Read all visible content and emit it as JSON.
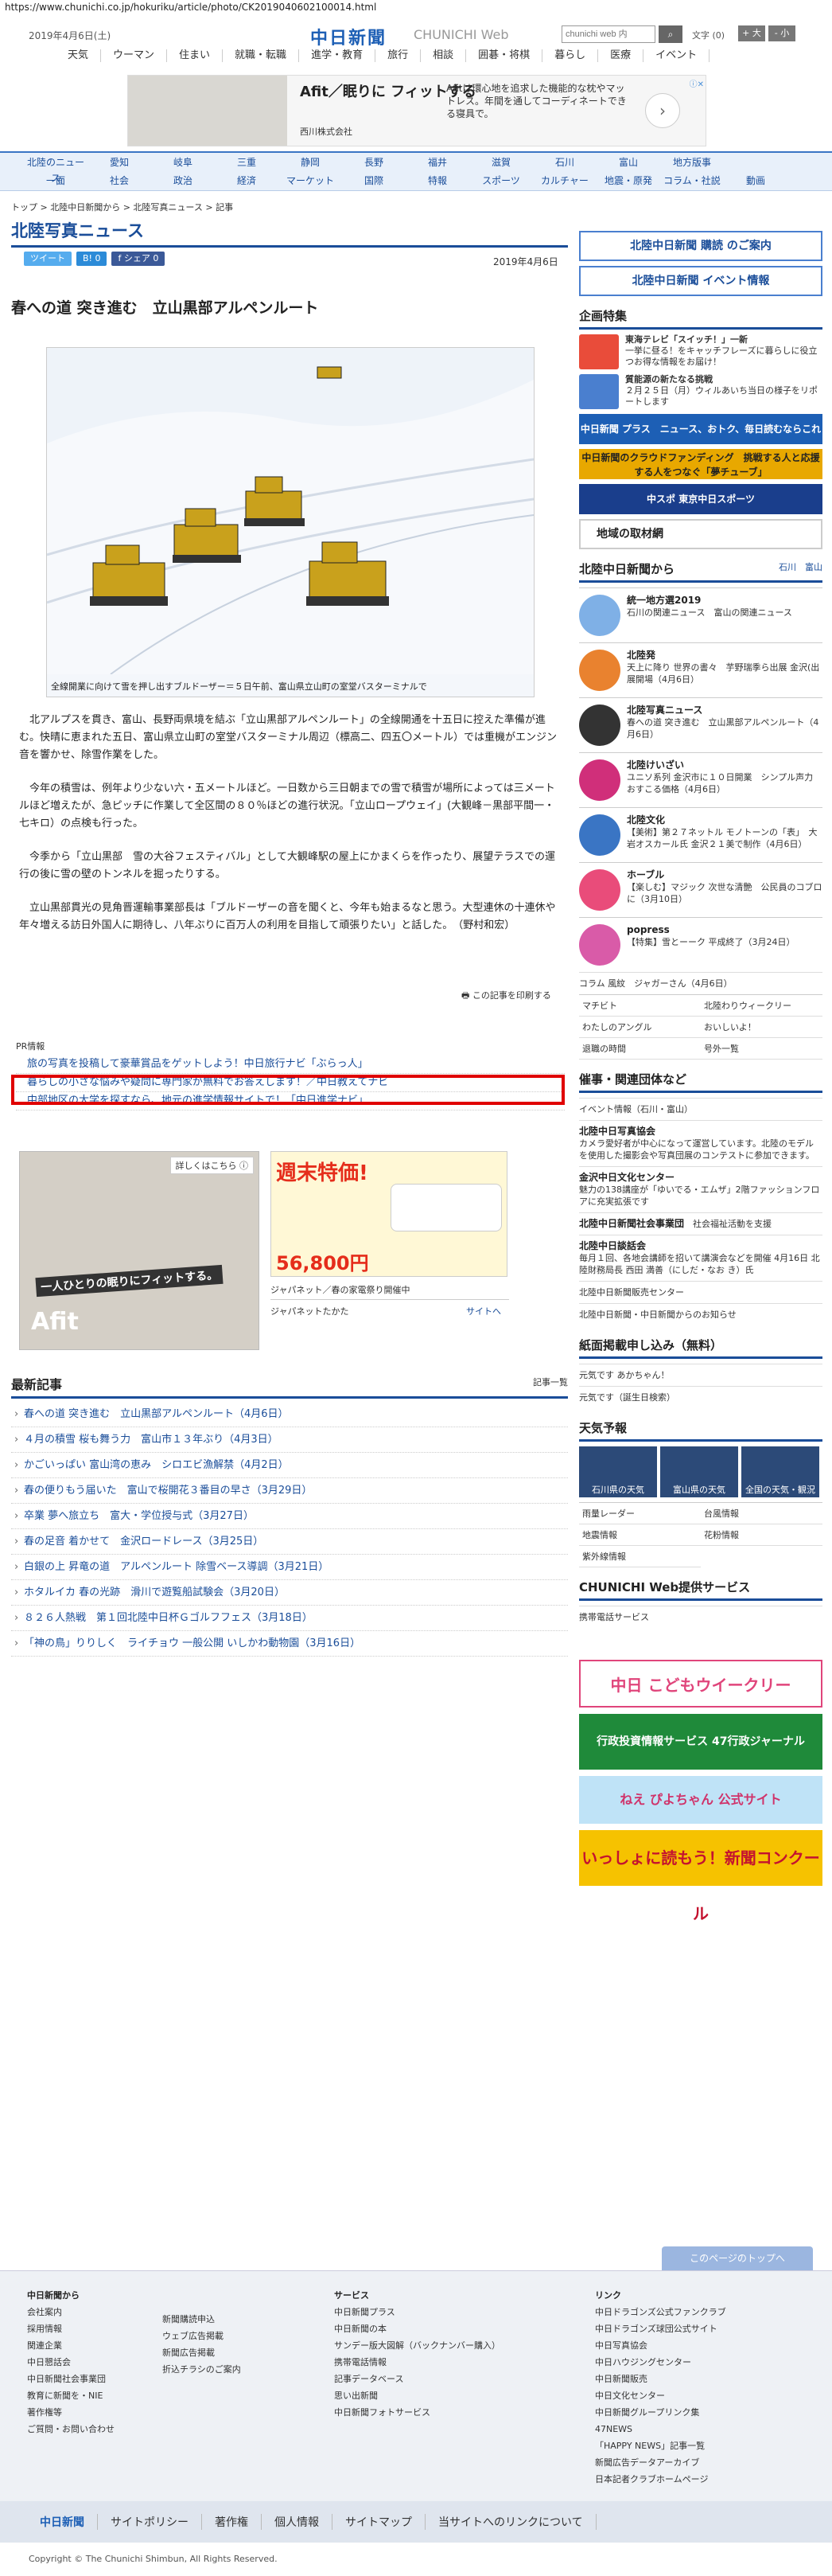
{
  "url": "https://www.chunichi.co.jp/hokuriku/article/photo/CK2019040602100014.html",
  "header": {
    "date": "2019年4月6日(土)",
    "logo": "中日新聞",
    "logo_sub": "CHUNICHI Web",
    "search_placeholder": "chunichi web 内",
    "fontsize_label": "文字 (0)",
    "font_large": "+ 大",
    "font_small": "- 小",
    "nav": [
      "天気",
      "ウーマン",
      "住まい",
      "就職・転職",
      "進学・教育",
      "旅行",
      "相談",
      "囲碁・将棋",
      "暮らし",
      "医療",
      "イベント"
    ]
  },
  "ad_top": {
    "title": "Afit／眠りに フィットする",
    "desc": "Afitは環心地を追求した機能的な枕やマットレス。年間を通してコーディネートできる寝具で。",
    "brand": "西川株式会社",
    "next": "›",
    "close": "ⓘ✕"
  },
  "bluenav": {
    "row1": [
      "北陸のニュース",
      "愛知",
      "岐阜",
      "三重",
      "静岡",
      "長野",
      "福井",
      "滋賀",
      "石川",
      "富山",
      "地方版事"
    ],
    "row2": [
      "一面",
      "社会",
      "政治",
      "経済",
      "マーケット",
      "国際",
      "特報",
      "スポーツ",
      "カルチャー",
      "地震・原発",
      "コラム・社説",
      "動画"
    ]
  },
  "breadcrumb": "トップ > 北陸中日新聞から > 北陸写真ニュース > 記事",
  "page_title": "北陸写真ニュース",
  "social": {
    "tweet": "ツイート",
    "hatena": "B! 0",
    "share": "f シェア 0"
  },
  "article": {
    "pubdate": "2019年4月6日",
    "headline": "春への道 突き進む　立山黒部アルペンルート",
    "caption": "全線開業に向けて雪を押し出すブルドーザー＝５日午前、富山県立山町の室堂バスターミナルで",
    "paragraphs": [
      "北アルプスを貫き、富山、長野両県境を結ぶ「立山黒部アルペンルート」の全線開通を十五日に控えた準備が進む。快晴に恵まれた五日、富山県立山町の室堂バスターミナル周辺（標高二、四五〇メートル）では重機がエンジン音を響かせ、除雪作業をした。",
      "今年の積雪は、例年より少ない六・五メートルほど。一日数から三日朝までの雪で積雪が場所によっては三メートルほど増えたが、急ピッチに作業して全区間の８０％ほどの進行状況。「立山ロープウェイ」(大観峰－黒部平間一・七キロ）の点検も行った。",
      "今季から「立山黒部　雪の大谷フェスティバル」として大観峰駅の屋上にかまくらを作ったり、展望テラスでの運行の後に雪の壁のトンネルを掘ったりする。",
      "立山黒部貫光の見角晋運輸事業部長は「ブルドーザーの音を聞くと、今年も始まるなと思う。大型連休の十連休や年々増える訪日外国人に期待し、八年ぶりに百万人の利用を目指して頑張りたい」と話した。　（野村和宏）"
    ],
    "print_link": "この記事を印刷する"
  },
  "pr": {
    "label": "PR情報",
    "items": [
      "旅の写真を投稿して豪華賞品をゲットしよう！中日旅行ナビ「ぶらっ人」",
      "暮らしの小さな悩みや疑問に専門家が無料でお答えします！／中日教えてナビ",
      "中部地区の大学を探すなら、地元の進学情報サイトで！「中日進学ナビ」"
    ]
  },
  "ad_left": {
    "tag": "詳しくはこちら ⓘ",
    "copy": "一人ひとりの眠りにフィットする。",
    "brand": "Afit"
  },
  "ad_right": {
    "tag": "広告",
    "big": "週末特価!",
    "price": "56,800円",
    "caption": "ジャパネット／春の家電祭り開催中",
    "source": "ジャパネットたかた",
    "link": "サイトへ"
  },
  "latest": {
    "title": "最新記事",
    "more": "記事一覧",
    "items": [
      "春への道 突き進む　立山黒部アルペンルート（4月6日）",
      "４月の積雪 桜も舞う力　富山市１３年ぶり（4月3日）",
      "かごいっぱい 富山湾の恵み　シロエビ漁解禁（4月2日）",
      "春の便りもう届いた　富山で桜開花３番目の早さ（3月29日）",
      "卒業 夢へ旅立ち　富大・学位授与式（3月27日）",
      "春の足音 着かせて　金沢ロードレース（3月25日）",
      "白銀の上 昇竜の道　アルペンルート 除雪ベース導調（3月21日）",
      "ホタルイカ 春の光跡　滑川で遊覧船試験会（3月20日）",
      "８２６人熱戦　第１回北陸中日杯Ｇゴルフフェス（3月18日）",
      "「神の鳥」りりしく　ライチョウ 一般公開 いしかわ動物園（3月16日）"
    ]
  },
  "sidebar": {
    "subscribe": "北陸中日新聞 購読 のご案内",
    "event": "北陸中日新聞 イベント情報",
    "kikaku_title": "企画特集",
    "kikaku": [
      {
        "title": "東海テレビ「スイッチ！」一新",
        "desc": "一挙に昼る！をキャッチフレーズに暮らしに役立つお得な情報をお届け！"
      },
      {
        "title": "質能源の新たなる挑戦",
        "desc": "２月２５日（月）ウィルあいち当日の様子をリポートします"
      }
    ],
    "banners": [
      "中日新聞 プラス　ニュース、おトク、毎日読むならこれ",
      "中日新聞のクラウドファンディング　挑戦する人と応援する人をつなぐ「夢チューブ」",
      "中スポ 東京中日スポーツ"
    ],
    "local_reporter": "地域の取材網",
    "from_title": "北陸中日新聞から",
    "from_tabs": [
      "石川",
      "富山"
    ],
    "from_items": [
      {
        "title": "統一地方選2019",
        "desc": "石川の関連ニュース　富山の関連ニュース"
      },
      {
        "title": "北陸発",
        "desc": "天上に降り 世界の書々　芋野瑞季ら出展 金沢(出展開場（4月6日）"
      },
      {
        "title": "北陸写真ニュース",
        "desc": "春への道 突き進む　立山黒部アルペンルート（4月6日）"
      },
      {
        "title": "北陸けいざい",
        "desc": "ユニソ系列 金沢市に１０日開業　シンプル声力 おすこる価格（4月6日）"
      },
      {
        "title": "北陸文化",
        "desc": "【美術】第２７ネットル モノトーンの「表」　大岩オスカール氏 金沢２１美で制作（4月6日）"
      },
      {
        "title": "ホーブル",
        "desc": "【楽しむ】マジック 次世な清艶　公民員のコブロに（3月10日）"
      },
      {
        "title": "popress",
        "desc": "【特集】雪とーーク 平成終了（3月24日）"
      }
    ],
    "column": "コラム 風紋　ジャガーさん（4月6日）",
    "links": [
      "マチビト",
      "北陸わりウィークリー",
      "わたしのアングル",
      "おいしいよ！",
      "退職の時間",
      "号外一覧"
    ],
    "events_title": "催事・関連団体など",
    "events_sub": "イベント情報（石川・富山）",
    "events": [
      {
        "title": "北陸中日写真協会",
        "desc": "カメラ愛好者が中心になって運営しています。北陸のモデルを使用した撮影会や写真団展のコンテストに参加できます。"
      },
      {
        "title": "金沢中日文化センター",
        "desc": "魅力の138講座が「ゆいでる・エムザ」2階ファッションフロアに充実拡張です"
      },
      {
        "title": "北陸中日新聞社会事業団",
        "desc": "社会福祉活動を支援"
      },
      {
        "title": "北陸中日談話会",
        "desc": "毎月１回、各地会講師を招いて講演会などを開催 4月16日 北陸財務局長 西田 満善（にしだ・なお き）氏"
      },
      {
        "title": "北陸中日新聞販売センター",
        "desc": ""
      },
      {
        "title": "北陸中日新聞・中日新聞からのお知らせ",
        "desc": ""
      }
    ],
    "classified_title": "紙面掲載申し込み（無料）",
    "classified": [
      "元気です あかちゃん！",
      "元気です（誕生日検索）"
    ],
    "weather_title": "天気予報",
    "weather": [
      "石川県の天気",
      "富山県の天気",
      "全国の天気・観況"
    ],
    "weather_links": [
      "雨量レーダー",
      "台風情報",
      "地震情報",
      "花粉情報",
      "紫外線情報"
    ],
    "web_title": "CHUNICHI Web提供サービス",
    "web_item": "携帯電話サービス",
    "big_banners": [
      "中日 こどもウイークリー",
      "行政投資情報サービス 47行政ジャーナル",
      "ねえ ぴよちゃん 公式サイト",
      "いっしょに読もう！新聞コンクール"
    ]
  },
  "gotop": "このページのトップへ",
  "footer": {
    "col1_title": "中日新聞から",
    "col1": [
      "会社案内",
      "採用情報",
      "関連企業",
      "中日懇話会",
      "中日新聞社会事業団",
      "教育に新聞を・NIE",
      "著作権等",
      "ご質問・お問い合わせ"
    ],
    "col2": [
      "新聞購読申込",
      "ウェブ広告掲載",
      "新聞広告掲載",
      "折込チラシのご案内"
    ],
    "col3_title": "サービス",
    "col3": [
      "中日新聞プラス",
      "中日新聞の本",
      "サンデー版大図解（バックナンバー購入）",
      "携帯電話情報",
      "記事データベース",
      "思い出新聞",
      "中日新聞フォトサービス"
    ],
    "col4_title": "リンク",
    "col4": [
      "中日ドラゴンズ公式ファンクラブ",
      "中日ドラゴンズ球団公式サイト",
      "中日写真協会",
      "中日ハウジングセンター",
      "中日新聞販売",
      "中日文化センター",
      "中日新聞グループリンク集",
      "47NEWS",
      "「HAPPY NEWS」記事一覧",
      "新聞広告データアーカイブ",
      "日本記者クラブホームページ"
    ],
    "nav": [
      "中日新聞",
      "サイトポリシー",
      "著作権",
      "個人情報",
      "サイトマップ",
      "当サイトへのリンクについて"
    ],
    "copyright": "Copyright © The Chunichi Shimbun, All Rights Reserved."
  }
}
